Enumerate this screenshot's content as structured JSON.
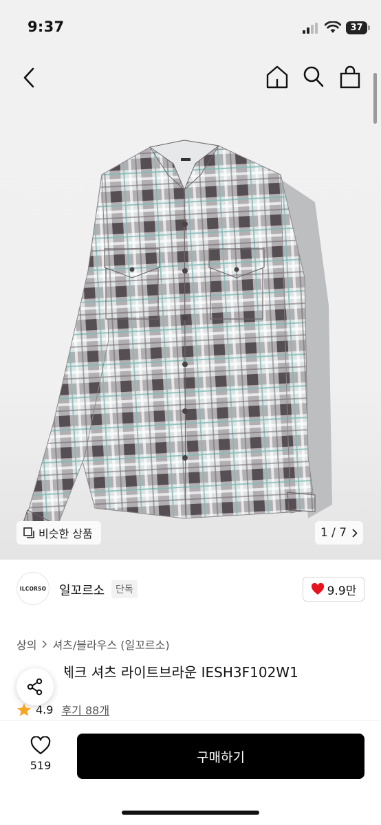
{
  "status": {
    "time": "9:37",
    "battery": "37"
  },
  "gallery": {
    "similar_label": "비슷한 상품",
    "page_current": "1",
    "page_total": "7"
  },
  "brand": {
    "logo_text": "ILCORSO",
    "name": "일꼬르소",
    "badge": "단독"
  },
  "likes": {
    "count": "9.9만"
  },
  "breadcrumb": [
    "상의",
    "셔츠/블라우스 (일꼬르소)"
  ],
  "product": {
    "title": "옴브레 체크 셔츠 라이트브라운 IESH3F102W1",
    "rating": "4.9",
    "reviews": "후기 88개"
  },
  "actions": {
    "wish_count": "519",
    "buy_label": "구매하기"
  },
  "colors": {
    "heart": "#e5141f",
    "star": "#f5a623",
    "buy_button": "#000000"
  }
}
